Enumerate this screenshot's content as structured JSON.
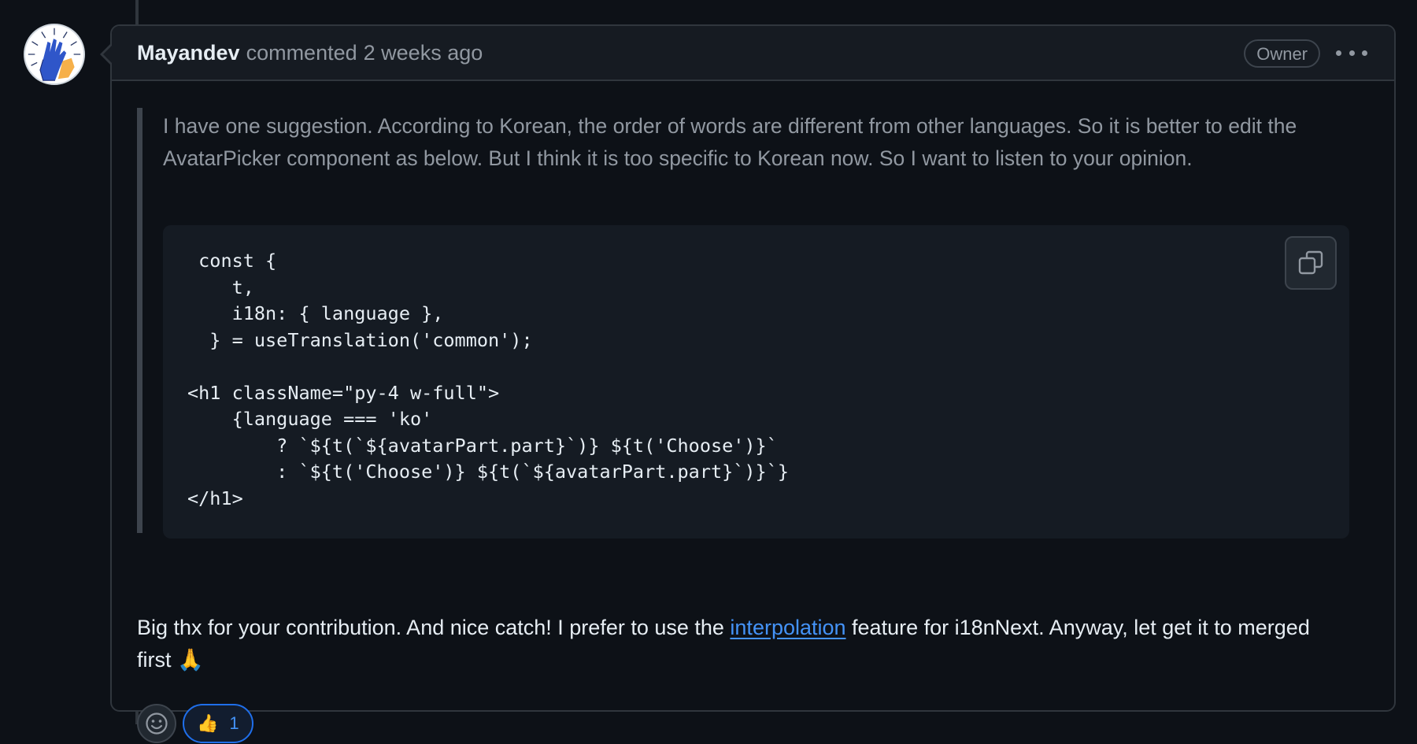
{
  "comment": {
    "author": "Mayandev",
    "action": "commented",
    "timestamp": "2 weeks ago",
    "badge": "Owner",
    "menu_icon": "kebab-horizontal-icon",
    "quote_text": "I have one suggestion. According to Korean, the order of words are different from other languages. So it is better to edit the AvatarPicker component as below. But I think it is too specific to Korean now. So I want to listen to your opinion.",
    "code": " const {\n    t,\n    i18n: { language },\n  } = useTranslation('common');\n\n<h1 className=\"py-4 w-full\">\n    {language === 'ko'\n        ? `${t(`${avatarPart.part}`)} ${t('Choose')}`\n        : `${t('Choose')} ${t(`${avatarPart.part}`)}`}\n</h1>",
    "copy_icon": "copy-icon",
    "reply_before_link": "Big thx for your contribution. And nice catch! I prefer to use the ",
    "reply_link": "interpolation",
    "reply_after_link": " feature for i18nNext. Anyway, let get it to merged first",
    "reply_emoji": "🙏",
    "reactions": {
      "add_icon": "smiley-icon",
      "thumbs_up_emoji": "👍",
      "thumbs_up_count": "1"
    }
  },
  "colors": {
    "background": "#0d1117",
    "header_bg": "#161b22",
    "border": "#30363d",
    "muted_text": "#9198a1",
    "link": "#4493f8",
    "code_bg": "#151b23"
  }
}
